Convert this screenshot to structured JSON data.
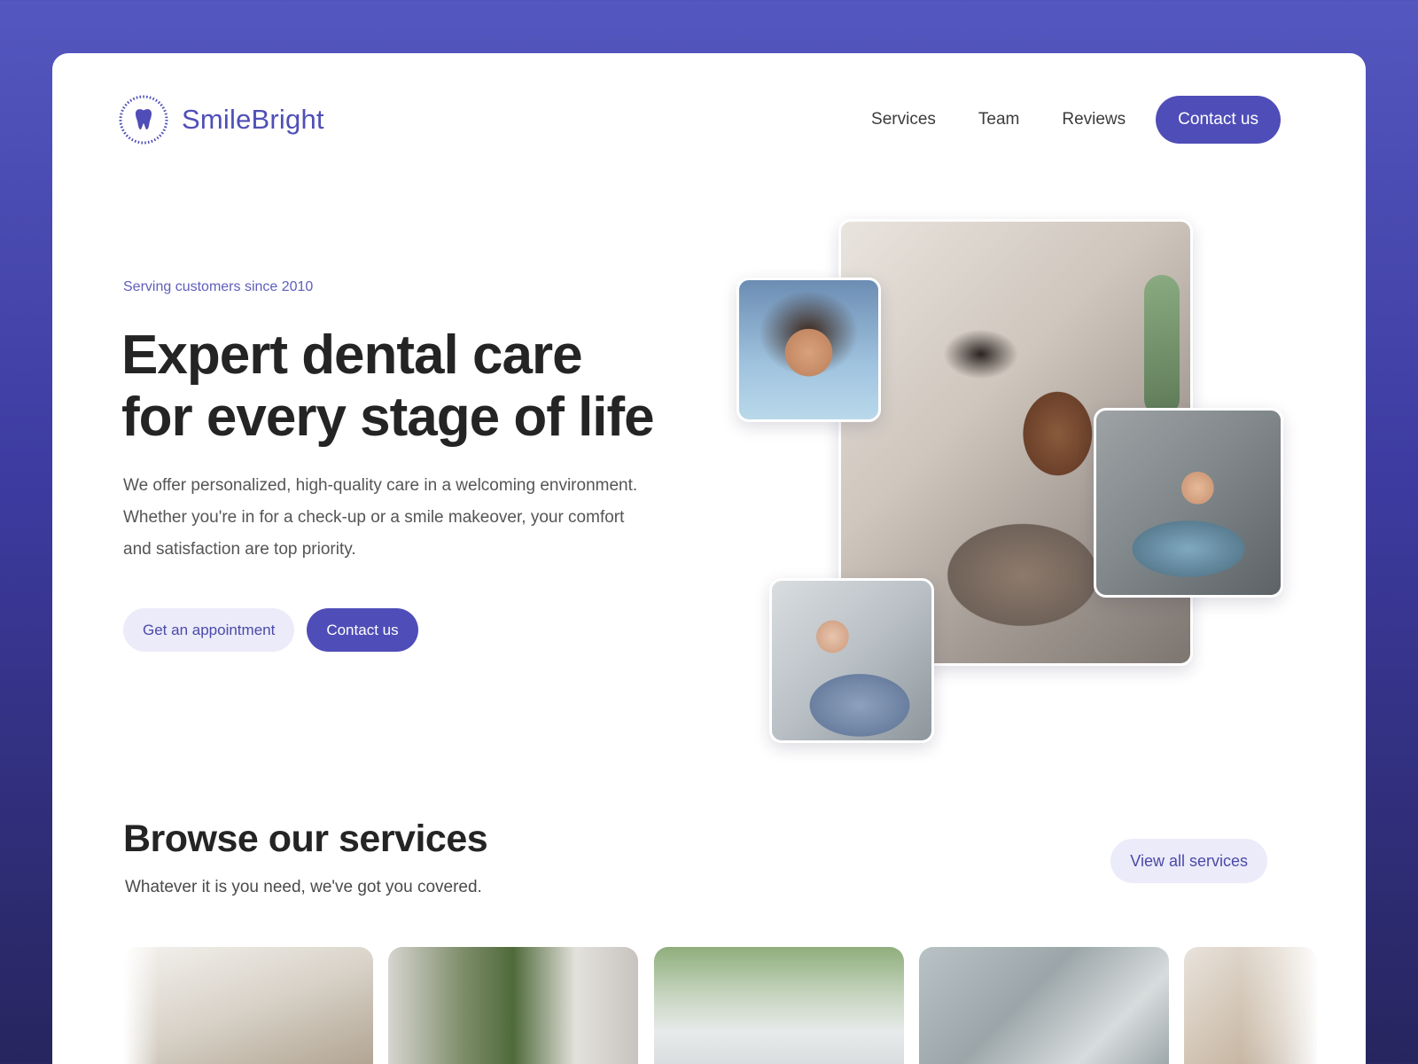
{
  "header": {
    "brand": "SmileBright",
    "nav": [
      {
        "label": "Services"
      },
      {
        "label": "Team"
      },
      {
        "label": "Reviews"
      }
    ],
    "contact_label": "Contact us"
  },
  "hero": {
    "eyebrow": "Serving customers since 2010",
    "title_lines": [
      "Expert dental care",
      "for every stage of life"
    ],
    "description_lines": [
      "We offer personalized, high-quality care in a welcoming environment.",
      "Whether you're in for a check-up or a smile makeover, your comfort",
      "and satisfaction are top priority."
    ],
    "appointment_label": "Get an appointment",
    "contact_label": "Contact us"
  },
  "services": {
    "title": "Browse our services",
    "subtitle": "Whatever it is you need, we've got you covered.",
    "view_all_label": "View all services"
  },
  "colors": {
    "brand": "#4f4db8",
    "brand_soft": "#ecebfa",
    "background_top": "#5457bf",
    "background_bottom": "#27255e",
    "heading": "#242424"
  },
  "icons": {
    "logo": "tooth-icon"
  }
}
